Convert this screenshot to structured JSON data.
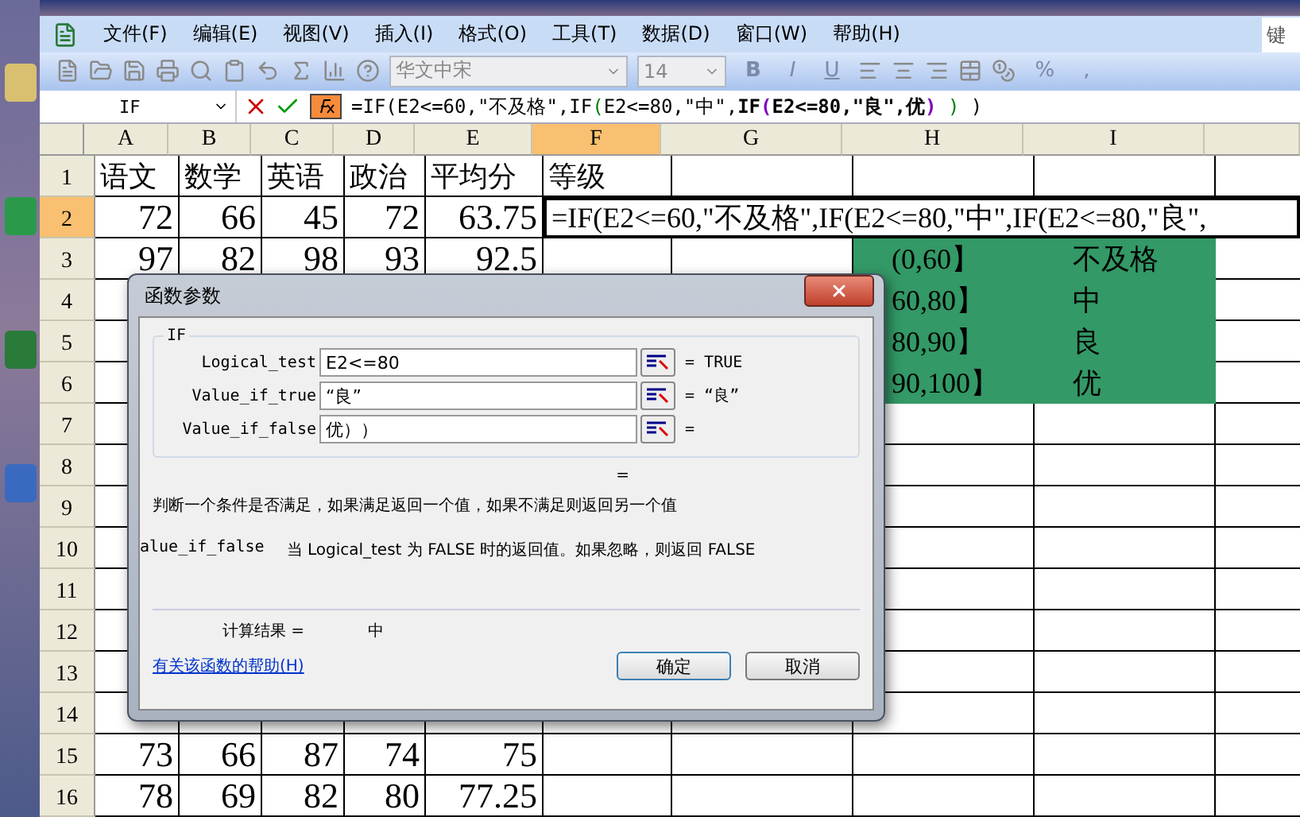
{
  "menu": {
    "items": [
      "文件(F)",
      "编辑(E)",
      "视图(V)",
      "插入(I)",
      "格式(O)",
      "工具(T)",
      "数据(D)",
      "窗口(W)",
      "帮助(H)"
    ],
    "help_box": "键"
  },
  "toolbar": {
    "font": "华文中宋",
    "size": "14",
    "format_buttons": [
      "B",
      "I",
      "U"
    ],
    "percent": "%",
    "comma": ","
  },
  "formula_bar": {
    "name_box": "IF",
    "segments": [
      {
        "text": "=IF(E2<=60,\"不及格\",IF",
        "color": "#000000",
        "bold": false
      },
      {
        "text": "(",
        "color": "#008000",
        "bold": false
      },
      {
        "text": "E2<=80,\"中\",",
        "color": "#000000",
        "bold": false
      },
      {
        "text": "IF",
        "color": "#000000",
        "bold": true
      },
      {
        "text": "(",
        "color": "#8000c0",
        "bold": true
      },
      {
        "text": "E2<=80,\"良\",优",
        "color": "#000000",
        "bold": true
      },
      {
        "text": ")",
        "color": "#8000c0",
        "bold": true
      },
      {
        "text": " )",
        "color": "#008000",
        "bold": false
      },
      {
        "text": " )",
        "color": "#000000",
        "bold": false
      }
    ]
  },
  "grid": {
    "columns": [
      {
        "label": "A",
        "selected": false
      },
      {
        "label": "B",
        "selected": false
      },
      {
        "label": "C",
        "selected": false
      },
      {
        "label": "D",
        "selected": false
      },
      {
        "label": "E",
        "selected": false
      },
      {
        "label": "F",
        "selected": true
      },
      {
        "label": "G",
        "selected": false
      },
      {
        "label": "H",
        "selected": false
      },
      {
        "label": "I",
        "selected": false
      }
    ],
    "rows": [
      {
        "number": "1",
        "selected": false,
        "cells": [
          {
            "text": "语文"
          },
          {
            "text": "数学"
          },
          {
            "text": "英语"
          },
          {
            "text": "政治"
          },
          {
            "text": "平均分"
          },
          {
            "text": "等级"
          }
        ]
      },
      {
        "number": "2",
        "selected": true,
        "cells": [
          {
            "text": "72"
          },
          {
            "text": "66"
          },
          {
            "text": "45"
          },
          {
            "text": "72"
          },
          {
            "text": "63.75"
          },
          {
            "text": "=IF(E2<=60,\"不及格\",IF(E2<=80,\"中\",IF(E2<=80,\"良\",",
            "spills": true
          }
        ]
      },
      {
        "number": "3",
        "selected": false,
        "cells": [
          {
            "text": "97"
          },
          {
            "text": "82"
          },
          {
            "text": "98"
          },
          {
            "text": "93"
          },
          {
            "text": "92.5"
          },
          {},
          {},
          {
            "text": "(0,60】",
            "filled": true
          },
          {
            "text": "不及格",
            "filled": true
          }
        ]
      },
      {
        "number": "4",
        "selected": false,
        "cells": [
          {},
          {},
          {},
          {},
          {},
          {},
          {},
          {
            "text": "60,80】",
            "filled": true
          },
          {
            "text": "中",
            "filled": true
          }
        ]
      },
      {
        "number": "5",
        "selected": false,
        "cells": [
          {},
          {},
          {},
          {},
          {},
          {},
          {},
          {
            "text": "80,90】",
            "filled": true
          },
          {
            "text": "良",
            "filled": true
          }
        ]
      },
      {
        "number": "6",
        "selected": false,
        "cells": [
          {},
          {},
          {},
          {},
          {},
          {},
          {},
          {
            "text": "90,100】",
            "filled": true
          },
          {
            "text": "优",
            "filled": true
          }
        ]
      },
      {
        "number": "7",
        "selected": false
      },
      {
        "number": "8",
        "selected": false
      },
      {
        "number": "9",
        "selected": false
      },
      {
        "number": "10",
        "selected": false
      },
      {
        "number": "11",
        "selected": false
      },
      {
        "number": "12",
        "selected": false
      },
      {
        "number": "13",
        "selected": false
      },
      {
        "number": "14",
        "selected": false
      },
      {
        "number": "15",
        "selected": false,
        "cells": [
          {
            "text": "73"
          },
          {
            "text": "66"
          },
          {
            "text": "87"
          },
          {
            "text": "74"
          },
          {
            "text": "75"
          }
        ]
      },
      {
        "number": "16",
        "selected": false,
        "cells": [
          {
            "text": "78"
          },
          {
            "text": "69"
          },
          {
            "text": "82"
          },
          {
            "text": "80"
          },
          {
            "text": "77.25"
          }
        ]
      }
    ]
  },
  "dialog": {
    "title": "函数参数",
    "function": "IF",
    "arguments": [
      {
        "label": "Logical_test",
        "value": "E2<=80",
        "sign": "=",
        "result": "TRUE"
      },
      {
        "label": "Value_if_true",
        "value": "“良”",
        "sign": "=",
        "result": "“良”"
      },
      {
        "label": "Value_if_false",
        "value": "优））",
        "sign": "="
      }
    ],
    "formula_sign": "=",
    "description": "判断一个条件是否满足，如果满足返回一个值，如果不满足则返回另一个值",
    "argument_name": "alue_if_false",
    "argument_help": "当 Logical_test 为 FALSE 时的返回值。如果忽略，则返回 FALSE",
    "result_label": "计算结果 =",
    "result_value": "中",
    "help_link": "有关该函数的帮助(H)",
    "buttons": [
      "确定",
      "取消"
    ]
  }
}
